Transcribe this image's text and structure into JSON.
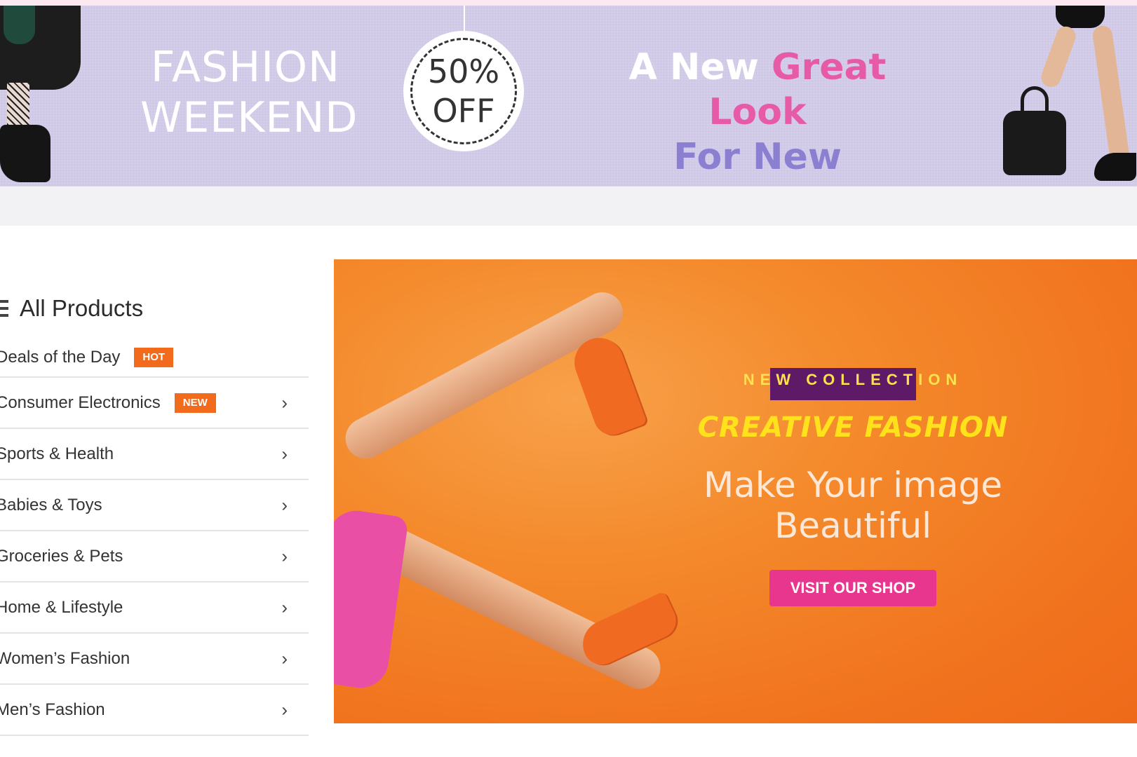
{
  "promo_banner": {
    "left_title": [
      "FASHION",
      "WEEKEND"
    ],
    "badge": [
      "50%",
      "OFF"
    ],
    "headline": {
      "prefix": "A New",
      "highlight": "Great Look",
      "line2": "For New Season"
    },
    "colors": {
      "background": "#cfc8e6",
      "highlight": "#e75aa8",
      "line2": "#8a7fd0"
    }
  },
  "sidebar": {
    "title": "All Products",
    "items": [
      {
        "label": "Deals of the Day",
        "badge": "HOT",
        "chevron": ""
      },
      {
        "label": "Consumer Electronics",
        "badge": "NEW",
        "chevron": "›"
      },
      {
        "label": "Sports & Health",
        "badge": "",
        "chevron": "›"
      },
      {
        "label": "Babies & Toys",
        "badge": "",
        "chevron": "›"
      },
      {
        "label": "Groceries & Pets",
        "badge": "",
        "chevron": "›"
      },
      {
        "label": "Home & Lifestyle",
        "badge": "",
        "chevron": "›"
      },
      {
        "label": "Women’s Fashion",
        "badge": "",
        "chevron": "›"
      },
      {
        "label": "Men’s Fashion",
        "badge": "",
        "chevron": "›"
      }
    ],
    "badge_color": "#f26a1b"
  },
  "hero": {
    "kicker": "NEW COLLECTION",
    "title": "CREATIVE FASHION",
    "subtitle": "Make Your image Beautiful",
    "button": "VISIT OUR SHOP",
    "colors": {
      "background": "#f1731e",
      "kicker_highlight": "#5e1a66",
      "title": "#ffe21b",
      "button": "#e8368f"
    }
  }
}
